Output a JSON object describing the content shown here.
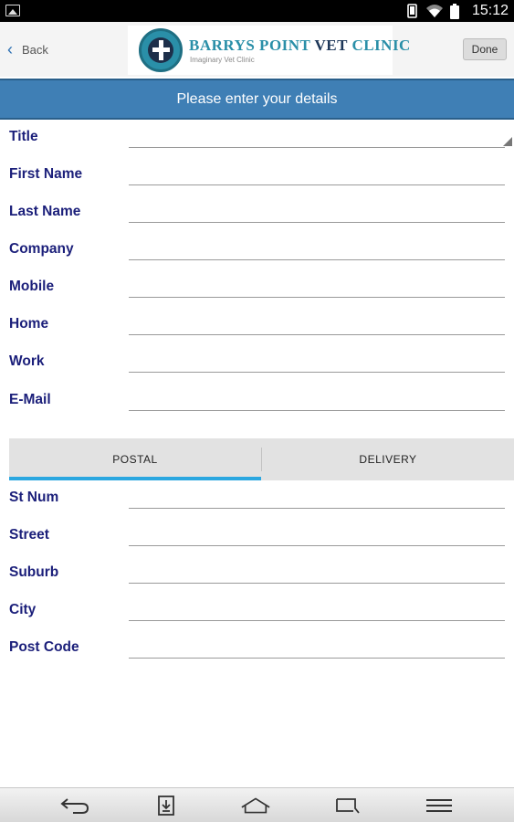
{
  "status_bar": {
    "time": "15:12",
    "icons": [
      "picture-icon",
      "phone-icon",
      "wifi-icon",
      "battery-icon"
    ]
  },
  "header": {
    "back_label": "Back",
    "logo_title_part1": "BARRYS POINT ",
    "logo_title_part2": "VET ",
    "logo_title_part3": "CLINIC",
    "logo_subtitle": "Imaginary Vet Clinic",
    "done_label": "Done"
  },
  "banner": {
    "text": "Please enter your details"
  },
  "contact_fields": [
    {
      "label": "Title",
      "value": ""
    },
    {
      "label": "First Name",
      "value": ""
    },
    {
      "label": "Last Name",
      "value": ""
    },
    {
      "label": "Company",
      "value": ""
    },
    {
      "label": "Mobile",
      "value": ""
    },
    {
      "label": "Home",
      "value": ""
    },
    {
      "label": "Work",
      "value": ""
    },
    {
      "label": "E-Mail",
      "value": ""
    }
  ],
  "address_tabs": {
    "postal": "POSTAL",
    "delivery": "DELIVERY",
    "selected": "POSTAL"
  },
  "address_fields": [
    {
      "label": "St Num",
      "value": ""
    },
    {
      "label": "Street",
      "value": ""
    },
    {
      "label": "Suburb",
      "value": ""
    },
    {
      "label": "City",
      "value": ""
    },
    {
      "label": "Post Code",
      "value": ""
    }
  ],
  "colors": {
    "banner": "#3f7fb5",
    "label_text": "#1b1f7a",
    "tab_indicator": "#2ba7e0",
    "logo_teal": "#2a8fa8",
    "logo_navy": "#1d3658"
  },
  "nav_bar": {
    "buttons": [
      "back-icon",
      "download-icon",
      "home-icon",
      "recents-icon",
      "menu-icon"
    ]
  }
}
